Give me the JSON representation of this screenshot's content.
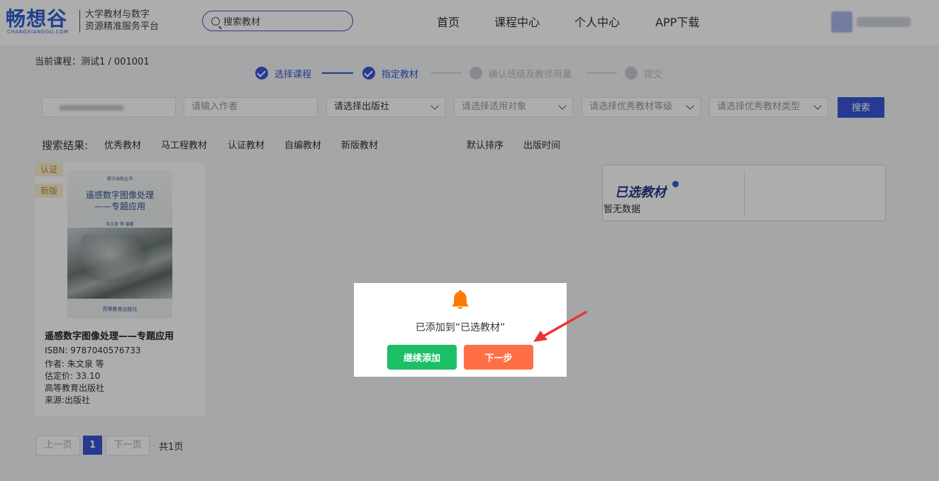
{
  "header": {
    "logo": {
      "text": "畅想谷",
      "sub": "CHANGXIANGGU.COM"
    },
    "slogan": [
      "大学教材与数字",
      "资源精准服务平台"
    ],
    "search": {
      "placeholder": "搜索教材"
    },
    "nav": [
      "首页",
      "课程中心",
      "个人中心",
      "APP下载"
    ]
  },
  "current_course": "当前课程：测试1 / 001001",
  "steps": [
    {
      "label": "选择课程",
      "status": "done"
    },
    {
      "label": "指定教材",
      "status": "done"
    },
    {
      "label": "确认班级及教师用量",
      "status": "pending"
    },
    {
      "label": "提交",
      "status": "pending"
    }
  ],
  "filters": {
    "author_placeholder": "请输入作者",
    "publisher": "请选择出版社",
    "audience": "请选择适用对象",
    "level": "请选择优秀教材等级",
    "type": "请选择优秀教材类型",
    "search_button": "搜索"
  },
  "results": {
    "label": "搜索结果:",
    "tags": [
      "优秀教材",
      "马工程教材",
      "认证教材",
      "自编教材",
      "新版教材"
    ],
    "sorts": [
      "默认排序",
      "出版时间"
    ]
  },
  "book": {
    "badges": [
      "认证",
      "新版"
    ],
    "cover": {
      "series": "数字出版丛书",
      "title_line1": "遥感数字图像处理",
      "title_line2": "——专题应用",
      "authors": "朱文泉 等 编著",
      "publisher": "高等教育出版社"
    },
    "title": "遥感数字图像处理——专题应用",
    "isbn": "ISBN: 9787040576733",
    "author": "作者: 朱文泉 等",
    "price": "估定价: 33.10",
    "publisher": "高等教育出版社",
    "source": "来源:出版社"
  },
  "selected": {
    "title": "已选教材",
    "empty": "暂无数据"
  },
  "pagination": {
    "prev": "上一页",
    "current": "1",
    "next": "下一页",
    "total": "共1页"
  },
  "modal": {
    "message": "已添加到“已选教材”",
    "continue": "继续添加",
    "next": "下一步"
  },
  "colors": {
    "primary": "#3856d6",
    "success": "#1bbf66",
    "accent": "#ff6f47",
    "bell": "#ff7a00",
    "arrow": "#ee3333"
  }
}
